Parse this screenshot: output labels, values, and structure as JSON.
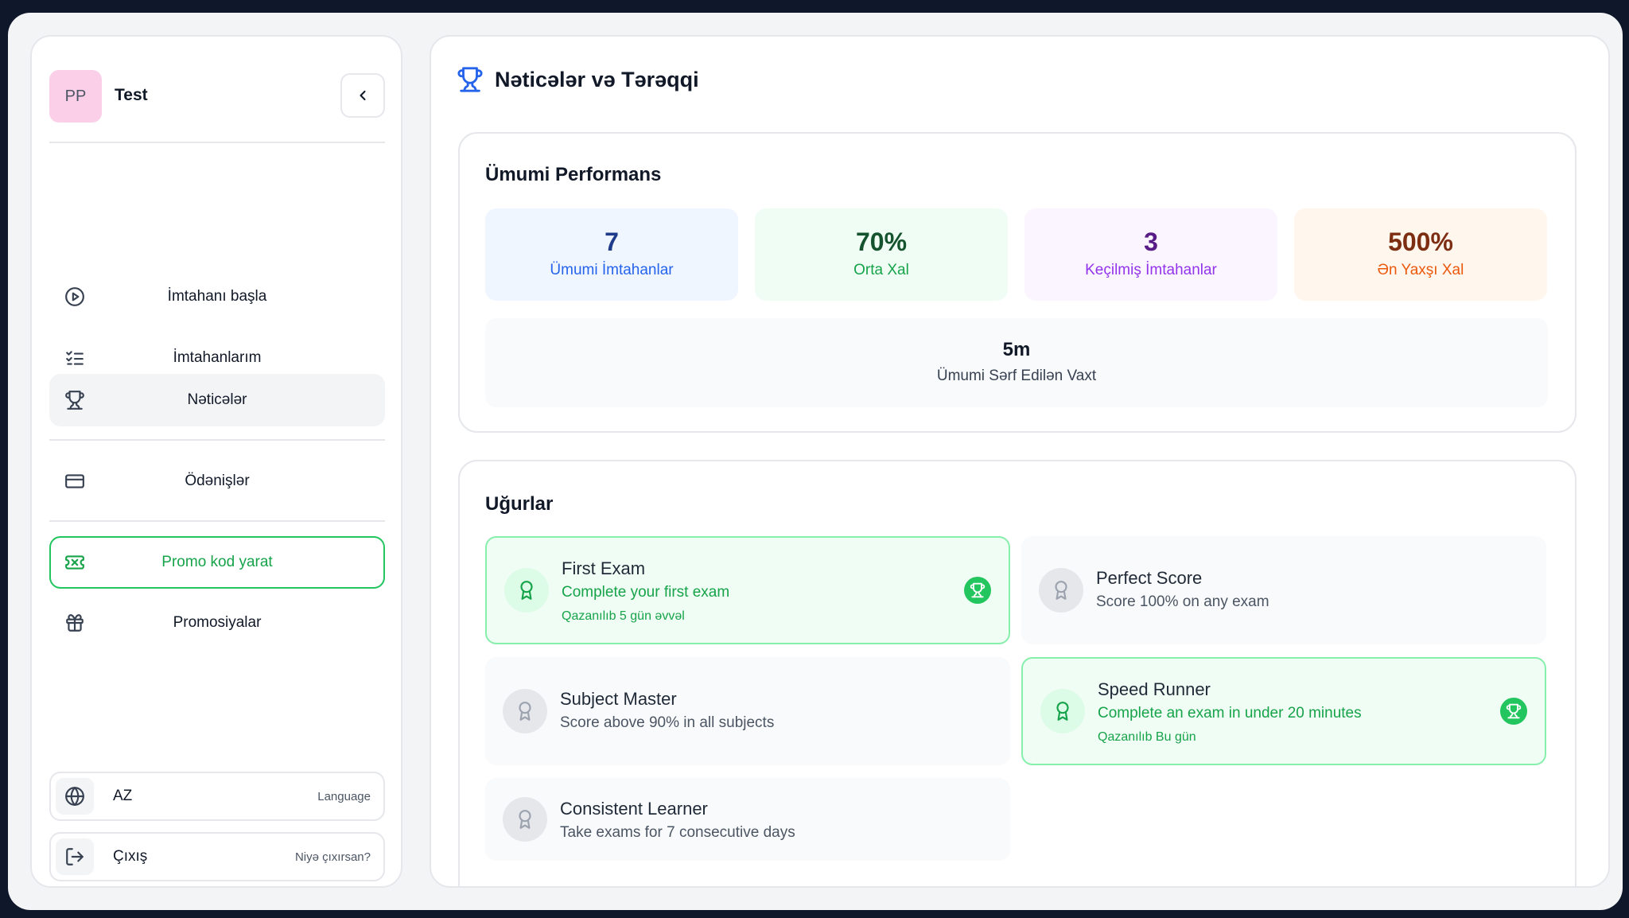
{
  "user": {
    "initials": "PP",
    "name": "Test"
  },
  "sidebar": {
    "items": [
      {
        "label": "İmtahanı başla",
        "icon": "play-circle-icon"
      },
      {
        "label": "İmtahanlarım",
        "icon": "checklist-icon"
      },
      {
        "label": "Nəticələr",
        "icon": "trophy-icon",
        "active": true
      },
      {
        "label": "Ödənişlər",
        "icon": "credit-card-icon"
      },
      {
        "label": "Promo kod yarat",
        "icon": "ticket-icon"
      },
      {
        "label": "Promosiyalar",
        "icon": "gift-icon"
      }
    ],
    "language": {
      "value": "AZ",
      "hint": "Language"
    },
    "logout": {
      "label": "Çıxış",
      "hint": "Niyə çıxırsan?"
    }
  },
  "page": {
    "title": "Nəticələr və Tərəqqi"
  },
  "performance": {
    "title": "Ümumi Performans",
    "stats": [
      {
        "value": "7",
        "label": "Ümumi İmtahanlar",
        "color": "#1e3a8a",
        "label_color": "#2563eb",
        "bg": "#eff6ff"
      },
      {
        "value": "70%",
        "label": "Orta Xal",
        "color": "#14532d",
        "label_color": "#16a34a",
        "bg": "#f0fdf4"
      },
      {
        "value": "3",
        "label": "Keçilmiş İmtahanlar",
        "color": "#581c87",
        "label_color": "#9333ea",
        "bg": "#faf5ff"
      },
      {
        "value": "500%",
        "label": "Ən Yaxşı Xal",
        "color": "#7c2d12",
        "label_color": "#ea580c",
        "bg": "#fff7ed"
      }
    ],
    "time": {
      "value": "5m",
      "label": "Ümumi Sərf Edilən Vaxt"
    }
  },
  "achievements": {
    "title": "Uğurlar",
    "items": [
      {
        "title": "First Exam",
        "desc": "Complete your first exam",
        "earned": true,
        "date": "Qazanılıb 5 gün əvvəl"
      },
      {
        "title": "Perfect Score",
        "desc": "Score 100% on any exam",
        "earned": false
      },
      {
        "title": "Subject Master",
        "desc": "Score above 90% in all subjects",
        "earned": false
      },
      {
        "title": "Speed Runner",
        "desc": "Complete an exam in under 20 minutes",
        "earned": true,
        "date": "Qazanılıb Bu gün"
      },
      {
        "title": "Consistent Learner",
        "desc": "Take exams for 7 consecutive days",
        "earned": false
      }
    ]
  }
}
